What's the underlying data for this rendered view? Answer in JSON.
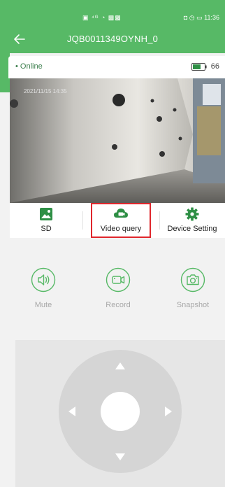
{
  "colors": {
    "primary": "#57b966",
    "highlight": "#e0262c",
    "control_disabled": "#a8a8a8"
  },
  "status_bar": {
    "left_icons": "▣ ⁴ᴳ ◔ ▩▩",
    "right_text": "◘ ◷ ▭ 11:36"
  },
  "header": {
    "back_icon": "back-arrow-icon",
    "title": "JQB0011349OYNH_0"
  },
  "device_info": {
    "status": "• Online",
    "battery_icon": "battery-icon",
    "battery_level": "66"
  },
  "video": {
    "timestamp": "2021/11/15 14:35"
  },
  "functions": [
    {
      "label": "SD",
      "icon": "sd-image-icon"
    },
    {
      "label": "Video query",
      "icon": "video-query-icon"
    },
    {
      "label": "Device Setting",
      "icon": "gear-icon"
    }
  ],
  "controls": [
    {
      "label": "Mute",
      "icon": "speaker-icon"
    },
    {
      "label": "Record",
      "icon": "video-camera-icon"
    },
    {
      "label": "Snapshot",
      "icon": "camera-icon"
    }
  ],
  "ptz": {
    "directions": [
      "up",
      "down",
      "left",
      "right"
    ]
  }
}
